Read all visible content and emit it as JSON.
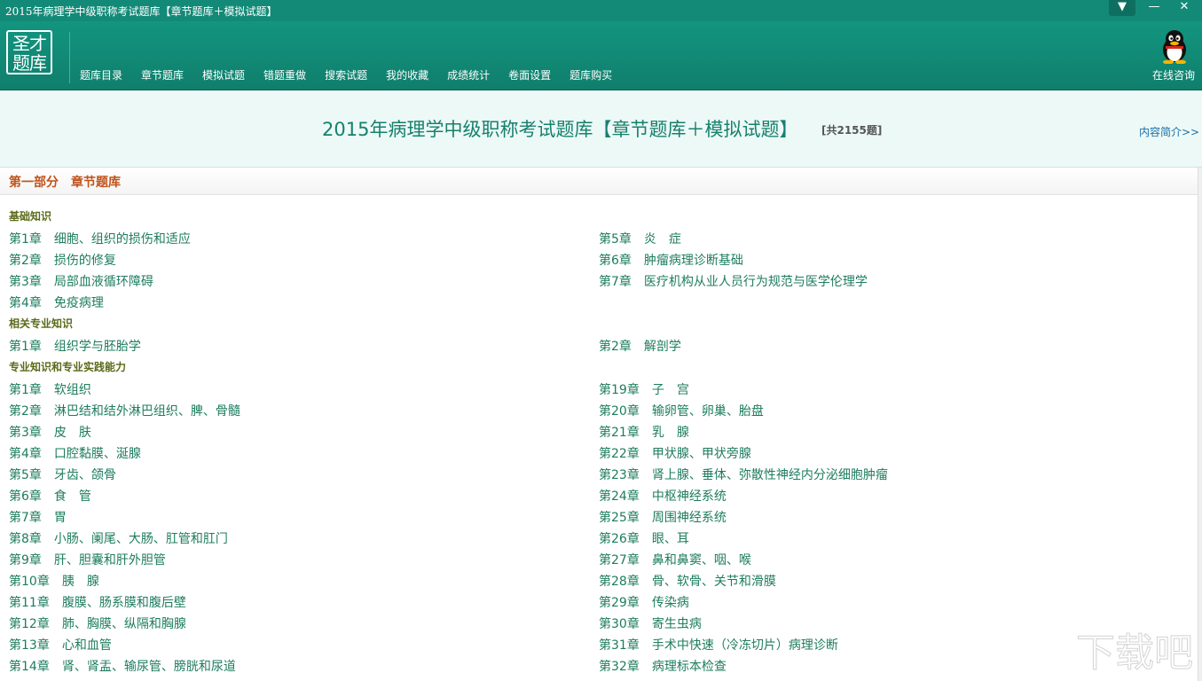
{
  "window": {
    "title": "2015年病理学中级职称考试题库【章节题库＋模拟试题】",
    "menu_icon": "dropdown-menu-icon",
    "minimize_icon": "minimize-icon",
    "close_icon": "close-icon"
  },
  "logo": {
    "line1": "圣才",
    "line2": "题库"
  },
  "nav": [
    "题库目录",
    "章节题库",
    "模拟试题",
    "错题重做",
    "搜索试题",
    "我的收藏",
    "成绩统计",
    "卷面设置",
    "题库购买"
  ],
  "consult": {
    "icon": "qq-penguin-icon",
    "label": "在线咨询"
  },
  "header": {
    "title": "2015年病理学中级职称考试题库【章节题库＋模拟试题】",
    "count": "[共2155题]",
    "intro_link": "内容简介>>"
  },
  "part": {
    "label": "第一部分　章节题库"
  },
  "categories": [
    {
      "name": "基础知识",
      "left": [
        {
          "num": "第1章",
          "title": "细胞、组织的损伤和适应"
        },
        {
          "num": "第2章",
          "title": "损伤的修复"
        },
        {
          "num": "第3章",
          "title": "局部血液循环障碍"
        },
        {
          "num": "第4章",
          "title": "免疫病理"
        }
      ],
      "right": [
        {
          "num": "第5章",
          "title": "炎　症"
        },
        {
          "num": "第6章",
          "title": "肿瘤病理诊断基础"
        },
        {
          "num": "第7章",
          "title": "医疗机构从业人员行为规范与医学伦理学"
        }
      ]
    },
    {
      "name": "相关专业知识",
      "left": [
        {
          "num": "第1章",
          "title": "组织学与胚胎学"
        }
      ],
      "right": [
        {
          "num": "第2章",
          "title": "解剖学"
        }
      ]
    },
    {
      "name": "专业知识和专业实践能力",
      "left": [
        {
          "num": "第1章",
          "title": "软组织"
        },
        {
          "num": "第2章",
          "title": "淋巴结和结外淋巴组织、脾、骨髓"
        },
        {
          "num": "第3章",
          "title": "皮　肤"
        },
        {
          "num": "第4章",
          "title": "口腔黏膜、涎腺"
        },
        {
          "num": "第5章",
          "title": "牙齿、颌骨"
        },
        {
          "num": "第6章",
          "title": "食　管"
        },
        {
          "num": "第7章",
          "title": "胃"
        },
        {
          "num": "第8章",
          "title": "小肠、阑尾、大肠、肛管和肛门"
        },
        {
          "num": "第9章",
          "title": "肝、胆囊和肝外胆管"
        },
        {
          "num": "第10章",
          "title": "胰　腺"
        },
        {
          "num": "第11章",
          "title": "腹膜、肠系膜和腹后壁"
        },
        {
          "num": "第12章",
          "title": "肺、胸膜、纵隔和胸腺"
        },
        {
          "num": "第13章",
          "title": "心和血管"
        },
        {
          "num": "第14章",
          "title": "肾、肾盂、输尿管、膀胱和尿道"
        }
      ],
      "right": [
        {
          "num": "第19章",
          "title": "子　宫"
        },
        {
          "num": "第20章",
          "title": "输卵管、卵巢、胎盘"
        },
        {
          "num": "第21章",
          "title": "乳　腺"
        },
        {
          "num": "第22章",
          "title": "甲状腺、甲状旁腺"
        },
        {
          "num": "第23章",
          "title": "肾上腺、垂体、弥散性神经内分泌细胞肿瘤"
        },
        {
          "num": "第24章",
          "title": "中枢神经系统"
        },
        {
          "num": "第25章",
          "title": "周围神经系统"
        },
        {
          "num": "第26章",
          "title": "眼、耳"
        },
        {
          "num": "第27章",
          "title": "鼻和鼻窦、咽、喉"
        },
        {
          "num": "第28章",
          "title": "骨、软骨、关节和滑膜"
        },
        {
          "num": "第29章",
          "title": "传染病"
        },
        {
          "num": "第30章",
          "title": "寄生虫病"
        },
        {
          "num": "第31章",
          "title": "手术中快速（冷冻切片）病理诊断"
        },
        {
          "num": "第32章",
          "title": "病理标本检查"
        }
      ]
    }
  ],
  "watermark": "下载吧"
}
